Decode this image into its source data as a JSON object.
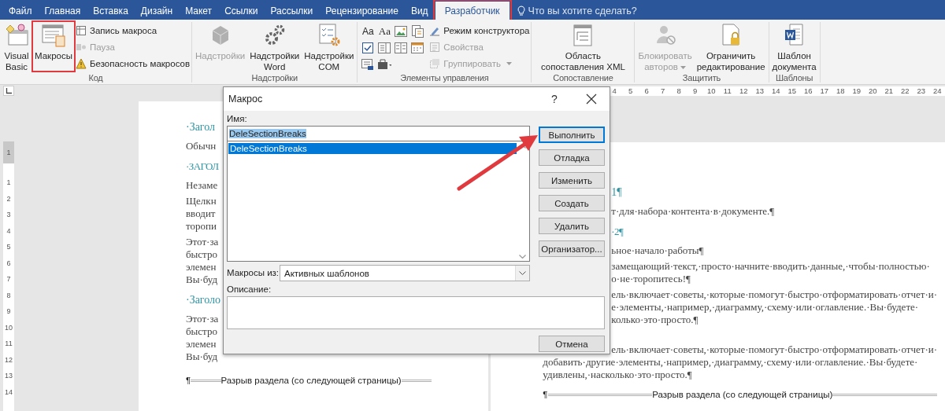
{
  "tabs": [
    {
      "label": "Файл",
      "selected": false,
      "highlighted": false
    },
    {
      "label": "Главная",
      "selected": false,
      "highlighted": false
    },
    {
      "label": "Вставка",
      "selected": false,
      "highlighted": false
    },
    {
      "label": "Дизайн",
      "selected": false,
      "highlighted": false
    },
    {
      "label": "Макет",
      "selected": false,
      "highlighted": false
    },
    {
      "label": "Ссылки",
      "selected": false,
      "highlighted": false
    },
    {
      "label": "Рассылки",
      "selected": false,
      "highlighted": false
    },
    {
      "label": "Рецензирование",
      "selected": false,
      "highlighted": false
    },
    {
      "label": "Вид",
      "selected": false,
      "highlighted": false
    },
    {
      "label": "Разработчик",
      "selected": true,
      "highlighted": true
    }
  ],
  "tell_me": {
    "placeholder": "Что вы хотите сделать?"
  },
  "ribbon": {
    "groups": [
      {
        "label": "Код",
        "items": [
          {
            "kind": "large",
            "label": "Visual Basic",
            "disabled": false,
            "highlighted": false
          },
          {
            "kind": "large",
            "label": "Макросы",
            "disabled": false,
            "highlighted": true
          },
          {
            "kind": "stack",
            "items": [
              {
                "label": "Запись макроса",
                "disabled": false
              },
              {
                "label": "Пауза",
                "disabled": true
              },
              {
                "label": "Безопасность макросов",
                "disabled": false
              }
            ]
          }
        ]
      },
      {
        "label": "Надстройки",
        "items": [
          {
            "kind": "large",
            "label": "Надстройки",
            "disabled": true,
            "highlighted": false
          },
          {
            "kind": "large",
            "label": "Надстройки Word",
            "disabled": false,
            "highlighted": false
          },
          {
            "kind": "large",
            "label": "Надстройки COM",
            "disabled": false,
            "highlighted": false
          }
        ]
      },
      {
        "label": "Элементы управления",
        "items": [
          {
            "kind": "grid",
            "cells": [
              {
                "kind": "text",
                "text": "Aa"
              },
              {
                "kind": "text",
                "text": "Aa"
              },
              {
                "kind": "icon"
              },
              {
                "kind": "icon"
              },
              {
                "kind": "icon"
              },
              {
                "kind": "icon"
              },
              {
                "kind": "icon"
              },
              {
                "kind": "icon"
              },
              {
                "kind": "icon"
              },
              {
                "kind": "icon"
              }
            ]
          },
          {
            "kind": "stack",
            "items": [
              {
                "label": "Режим конструктора",
                "disabled": false
              },
              {
                "label": "Свойства",
                "disabled": true
              },
              {
                "label": "Группировать",
                "disabled": true,
                "dropdown": true
              }
            ]
          }
        ]
      },
      {
        "label": "Сопоставление",
        "items": [
          {
            "kind": "large",
            "label": "Область сопоставления XML",
            "disabled": false,
            "highlighted": false
          }
        ]
      },
      {
        "label": "Защитить",
        "items": [
          {
            "kind": "large",
            "label": "Блокировать авторов",
            "disabled": true,
            "highlighted": false,
            "dropdown": true
          },
          {
            "kind": "large",
            "label": "Ограничить редактирование",
            "disabled": false,
            "highlighted": false
          }
        ]
      },
      {
        "label": "Шаблоны",
        "items": [
          {
            "kind": "large",
            "label": "Шаблон документа",
            "disabled": false,
            "highlighted": false
          }
        ]
      }
    ]
  },
  "document": {
    "horizontal_ruler": [
      "4",
      "5",
      "6",
      "7",
      "8",
      "9",
      "10",
      "11",
      "12",
      "13",
      "14",
      "15",
      "16",
      "17",
      "18",
      "19",
      "20",
      "21",
      "22",
      "23",
      "24"
    ],
    "vertical_ruler": [
      "1",
      "1",
      "2",
      "3",
      "4",
      "5",
      "6",
      "7",
      "8",
      "9",
      "10",
      "11",
      "12",
      "13",
      "14"
    ],
    "left_page": {
      "lines": [
        {
          "kind": "heading",
          "text": "·Загол"
        },
        {
          "kind": "first",
          "text": "Обычн"
        },
        {
          "kind": "heading2",
          "text": "·ЗАГОЛ"
        },
        {
          "kind": "first",
          "text": "Незаме"
        },
        {
          "kind": "first",
          "text": "Щелкн"
        },
        {
          "kind": "line",
          "text": "вводит"
        },
        {
          "kind": "line",
          "text": "торопи"
        },
        {
          "kind": "first",
          "text": "Этот·за"
        },
        {
          "kind": "line",
          "text": "быстро"
        },
        {
          "kind": "line",
          "text": "элемен"
        },
        {
          "kind": "line",
          "text": "Вы·буд"
        },
        {
          "kind": "heading",
          "text": "·Заголо"
        },
        {
          "kind": "first",
          "text": "Этот·за"
        },
        {
          "kind": "line",
          "text": "быстро"
        },
        {
          "kind": "line",
          "text": "элемен"
        },
        {
          "kind": "line",
          "text": "Вы·буд"
        },
        {
          "kind": "break",
          "mark": "¶",
          "text": "Разрыв раздела (со следующей страницы)"
        }
      ]
    },
    "right_page": {
      "upper_lines": [
        {
          "kind": "heading",
          "text": "1¶"
        },
        {
          "kind": "first",
          "text": "т·для·набора·контента·в·документе.¶"
        },
        {
          "kind": "heading2",
          "text": "·2¶"
        },
        {
          "kind": "first",
          "text": "ьное·начало·работы¶"
        },
        {
          "kind": "first",
          "text": "замещающий·текст,·просто·начните·вводить·данные,·чтобы·полностью·"
        },
        {
          "kind": "line",
          "text": "о·не·торопитесь!¶"
        },
        {
          "kind": "first",
          "text": "ель·включает·советы,·которые·помогут·быстро·отформатировать·отчет·и·"
        },
        {
          "kind": "line",
          "text": "е·элементы,·например,·диаграмму,·схему·или·оглавление.·Вы·будете·"
        },
        {
          "kind": "line",
          "text": "колько·это·просто.¶"
        }
      ],
      "lower_lines": [
        {
          "kind": "first",
          "text": "ель·включает·советы,·которые·помогут·быстро·отформатировать·отчет·и·"
        },
        {
          "kind": "line",
          "text": "добавить·другие·элементы,·например,·диаграмму,·схему·или·оглавление.·Вы·будете·"
        },
        {
          "kind": "line",
          "text": "удивлены,·насколько·это·просто.¶"
        },
        {
          "kind": "break",
          "mark": "¶",
          "text": "Разрыв раздела (со следующей страницы)"
        }
      ]
    }
  },
  "dialog": {
    "title": "Макрос",
    "help": "?",
    "name_label": "Имя:",
    "name_value": "DeleSectionBreaks",
    "name_selected": true,
    "macros": [
      {
        "label": "DeleSectionBreaks",
        "selected": true
      }
    ],
    "buttons": [
      {
        "label": "Выполнить",
        "default": true
      },
      {
        "label": "Отладка",
        "default": false
      },
      {
        "label": "Изменить",
        "default": false
      },
      {
        "label": "Создать",
        "default": false
      },
      {
        "label": "Удалить",
        "default": false
      },
      {
        "label": "Организатор...",
        "default": false
      }
    ],
    "source_label": "Макросы из:",
    "source_value": "Активных шаблонов",
    "description_label": "Описание:",
    "cancel": "Отмена"
  }
}
